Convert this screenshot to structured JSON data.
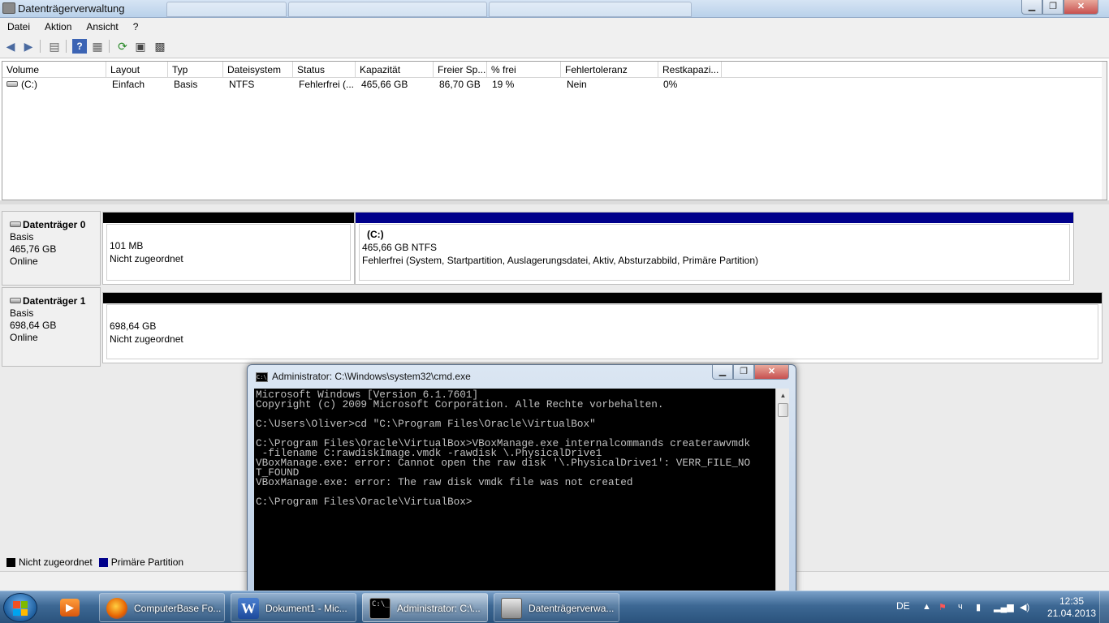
{
  "window": {
    "title": "Datenträgerverwaltung",
    "minimize": "▁",
    "maximize": "❐",
    "close": "✕"
  },
  "menu": [
    "Datei",
    "Aktion",
    "Ansicht",
    "?"
  ],
  "toolbar_icons": [
    "back-arrow-icon",
    "forward-arrow-icon",
    "properties-icon",
    "help-icon",
    "list-icon",
    "refresh-icon",
    "rescan-icon",
    "settings-icon"
  ],
  "volume_list": {
    "columns": [
      "Volume",
      "Layout",
      "Typ",
      "Dateisystem",
      "Status",
      "Kapazität",
      "Freier Sp...",
      "% frei",
      "Fehlertoleranz",
      "Restkapazi..."
    ],
    "rows": [
      [
        "(C:)",
        "Einfach",
        "Basis",
        "NTFS",
        "Fehlerfrei (...",
        "465,66 GB",
        "86,70 GB",
        "19 %",
        "Nein",
        "0%"
      ]
    ]
  },
  "disks": [
    {
      "name": "Datenträger 0",
      "type": "Basis",
      "size": "465,76 GB",
      "state": "Online",
      "partitions": [
        {
          "label": "",
          "size": "101 MB",
          "desc": "Nicht zugeordnet",
          "color": "#000000"
        },
        {
          "label": "(C:)",
          "size": "465,66 GB NTFS",
          "desc": "Fehlerfrei (System, Startpartition, Auslagerungsdatei, Aktiv, Absturzabbild, Primäre Partition)",
          "color": "#00008b"
        }
      ]
    },
    {
      "name": "Datenträger 1",
      "type": "Basis",
      "size": "698,64 GB",
      "state": "Online",
      "partitions": [
        {
          "label": "",
          "size": "698,64 GB",
          "desc": "Nicht zugeordnet",
          "color": "#000000"
        }
      ]
    }
  ],
  "legend": [
    {
      "label": "Nicht zugeordnet",
      "color": "#000000"
    },
    {
      "label": "Primäre Partition",
      "color": "#00008b"
    }
  ],
  "cmd": {
    "title": "Administrator: C:\\Windows\\system32\\cmd.exe",
    "icon_text": "C:\\_",
    "lines": [
      "Microsoft Windows [Version 6.1.7601]",
      "Copyright (c) 2009 Microsoft Corporation. Alle Rechte vorbehalten.",
      "",
      "C:\\Users\\Oliver>cd \"C:\\Program Files\\Oracle\\VirtualBox\"",
      "",
      "C:\\Program Files\\Oracle\\VirtualBox>VBoxManage.exe internalcommands createrawvmdk",
      " -filename C:rawdiskImage.vmdk -rawdisk \\.PhysicalDrive1",
      "VBoxManage.exe: error: Cannot open the raw disk '\\.PhysicalDrive1': VERR_FILE_NO",
      "T_FOUND",
      "VBoxManage.exe: error: The raw disk vmdk file was not created",
      "",
      "C:\\Program Files\\Oracle\\VirtualBox>"
    ]
  },
  "taskbar": {
    "tasks": [
      {
        "label": "ComputerBase Fo...",
        "icon": "firefox-icon"
      },
      {
        "label": "Dokument1 - Mic...",
        "icon": "word-icon"
      },
      {
        "label": "Administrator: C:\\...",
        "icon": "cmd-icon",
        "active": true
      },
      {
        "label": "Datenträgerverwa...",
        "icon": "disk-management-icon"
      }
    ],
    "language": "DE",
    "time": "12:35",
    "date": "21.04.2013"
  }
}
